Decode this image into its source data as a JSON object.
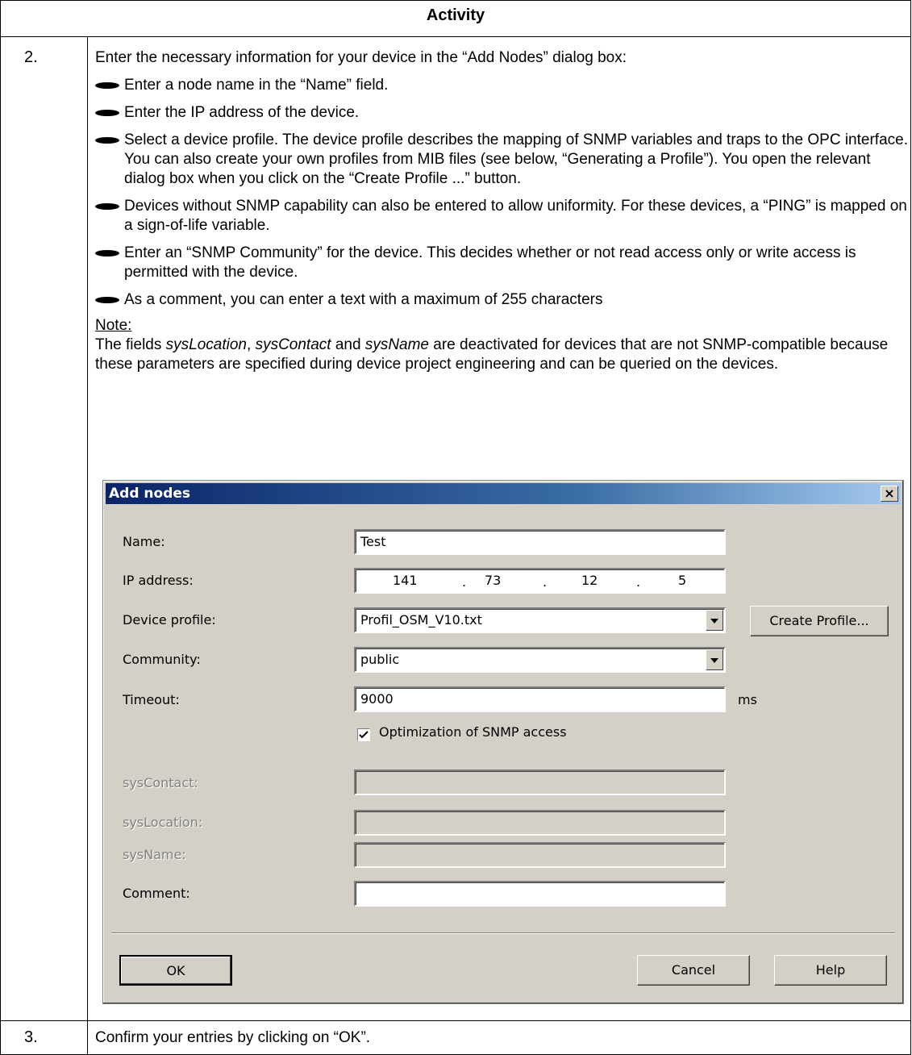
{
  "table": {
    "header": "Activity",
    "step2": {
      "num": "2.",
      "intro": "Enter the necessary information for your device in the “Add Nodes” dialog box:",
      "bullets": [
        "Enter a node name in the “Name” field.",
        "Enter the IP address of the device.",
        "Select a device profile. The device profile describes the mapping of SNMP variables and traps to the OPC interface. You can also create your own profiles from MIB files (see below, “Generating a Profile”). You open the relevant dialog box when you click on the “Create Profile ...” button.",
        "Devices without SNMP capability can also be entered to allow uniformity. For these devices, a “PING” is mapped on a sign-of-life variable.",
        "Enter an “SNMP Community” for the device. This decides whether or not read access only or write access is permitted with the device.",
        "As a comment, you can enter a text with a maximum of 255 characters"
      ],
      "note_label": "Note:",
      "note_prefix": "The fields ",
      "note_field1": "sysLocation",
      "note_sep1": ", ",
      "note_field2": "sysContact",
      "note_sep2": " and ",
      "note_field3": "sysName",
      "note_rest": " are deactivated for devices that are not SNMP-compatible because these parameters are specified during device project engineering and can be queried on the devices."
    },
    "step3": {
      "num": "3.",
      "text": "Confirm your entries by clicking on “OK”."
    }
  },
  "dialog": {
    "title": "Add nodes",
    "close_glyph": "×",
    "name_label": "Name:",
    "name_value": "Test",
    "ip_label": "IP address:",
    "ip_octets": [
      "141",
      "73",
      "12",
      "5"
    ],
    "ip_dot": ".",
    "profile_label": "Device profile:",
    "profile_value": "Profil_OSM_V10.txt",
    "create_profile_button": "Create Profile...",
    "community_label": "Community:",
    "community_value": "public",
    "timeout_label": "Timeout:",
    "timeout_value": "9000",
    "timeout_unit": "ms",
    "optimization_label": "Optimization of SNMP access",
    "optimization_checked": true,
    "syscontact_label": "sysContact:",
    "syslocation_label": "sysLocation:",
    "sysname_label": "sysName:",
    "comment_label": "Comment:",
    "comment_value": "",
    "ok_button": "OK",
    "cancel_button": "Cancel",
    "help_button": "Help"
  }
}
